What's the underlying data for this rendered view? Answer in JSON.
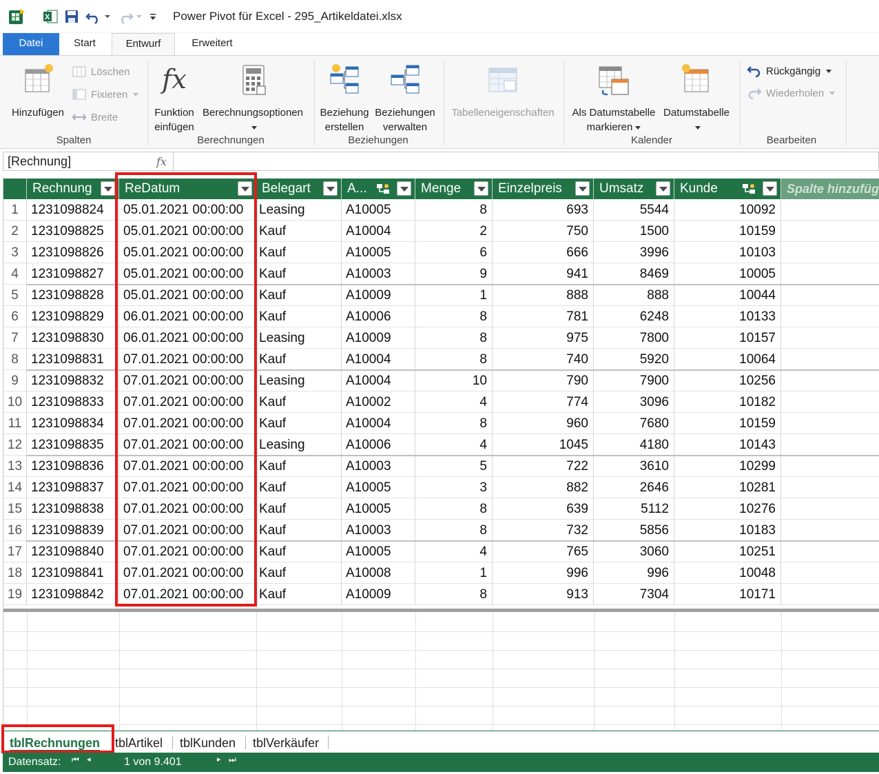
{
  "window": {
    "title": "Power Pivot für Excel - 295_Artikeldatei.xlsx"
  },
  "tabs": [
    {
      "label": "Datei"
    },
    {
      "label": "Start"
    },
    {
      "label": "Entwurf"
    },
    {
      "label": "Erweitert"
    }
  ],
  "ribbon": {
    "spalten": {
      "label": "Spalten",
      "add": "Hinzufügen",
      "delete": "Löschen",
      "freeze": "Fixieren",
      "width": "Breite"
    },
    "berechnungen": {
      "label": "Berechnungen",
      "insert_function_1": "Funktion",
      "insert_function_2": "einfügen",
      "options": "Berechnungsoptionen"
    },
    "beziehungen": {
      "label": "Beziehungen",
      "create_1": "Beziehung",
      "create_2": "erstellen",
      "manage_1": "Beziehungen",
      "manage_2": "verwalten"
    },
    "table_props": "Tabelleneigenschaften",
    "kalender": {
      "label": "Kalender",
      "mark_1": "Als Datumstabelle",
      "mark_2": "markieren",
      "date_table": "Datumstabelle"
    },
    "bearbeiten": {
      "label": "Bearbeiten",
      "undo": "Rückgängig",
      "redo": "Wiederholen"
    }
  },
  "formula_bar": {
    "name_box": "[Rechnung]",
    "fx": "fx"
  },
  "table": {
    "headers": [
      "Rechnung",
      "ReDatum",
      "Belegart",
      "A...",
      "Menge",
      "Einzelpreis",
      "Umsatz",
      "Kunde",
      "Spalte hinzufüg"
    ],
    "rows": [
      [
        "1",
        "1231098824",
        "05.01.2021 00:00:00",
        "Leasing",
        "A10005",
        "8",
        "693",
        "5544",
        "10092"
      ],
      [
        "2",
        "1231098825",
        "05.01.2021 00:00:00",
        "Kauf",
        "A10004",
        "2",
        "750",
        "1500",
        "10159"
      ],
      [
        "3",
        "1231098826",
        "05.01.2021 00:00:00",
        "Kauf",
        "A10005",
        "6",
        "666",
        "3996",
        "10103"
      ],
      [
        "4",
        "1231098827",
        "05.01.2021 00:00:00",
        "Kauf",
        "A10003",
        "9",
        "941",
        "8469",
        "10005"
      ],
      [
        "5",
        "1231098828",
        "05.01.2021 00:00:00",
        "Kauf",
        "A10009",
        "1",
        "888",
        "888",
        "10044"
      ],
      [
        "6",
        "1231098829",
        "06.01.2021 00:00:00",
        "Kauf",
        "A10006",
        "8",
        "781",
        "6248",
        "10133"
      ],
      [
        "7",
        "1231098830",
        "06.01.2021 00:00:00",
        "Leasing",
        "A10009",
        "8",
        "975",
        "7800",
        "10157"
      ],
      [
        "8",
        "1231098831",
        "07.01.2021 00:00:00",
        "Kauf",
        "A10004",
        "8",
        "740",
        "5920",
        "10064"
      ],
      [
        "9",
        "1231098832",
        "07.01.2021 00:00:00",
        "Leasing",
        "A10004",
        "10",
        "790",
        "7900",
        "10256"
      ],
      [
        "10",
        "1231098833",
        "07.01.2021 00:00:00",
        "Kauf",
        "A10002",
        "4",
        "774",
        "3096",
        "10182"
      ],
      [
        "11",
        "1231098834",
        "07.01.2021 00:00:00",
        "Kauf",
        "A10004",
        "8",
        "960",
        "7680",
        "10159"
      ],
      [
        "12",
        "1231098835",
        "07.01.2021 00:00:00",
        "Leasing",
        "A10006",
        "4",
        "1045",
        "4180",
        "10143"
      ],
      [
        "13",
        "1231098836",
        "07.01.2021 00:00:00",
        "Kauf",
        "A10003",
        "5",
        "722",
        "3610",
        "10299"
      ],
      [
        "14",
        "1231098837",
        "07.01.2021 00:00:00",
        "Kauf",
        "A10005",
        "3",
        "882",
        "2646",
        "10281"
      ],
      [
        "15",
        "1231098838",
        "07.01.2021 00:00:00",
        "Kauf",
        "A10005",
        "8",
        "639",
        "5112",
        "10276"
      ],
      [
        "16",
        "1231098839",
        "07.01.2021 00:00:00",
        "Kauf",
        "A10003",
        "8",
        "732",
        "5856",
        "10183"
      ],
      [
        "17",
        "1231098840",
        "07.01.2021 00:00:00",
        "Kauf",
        "A10005",
        "4",
        "765",
        "3060",
        "10251"
      ],
      [
        "18",
        "1231098841",
        "07.01.2021 00:00:00",
        "Kauf",
        "A10008",
        "1",
        "996",
        "996",
        "10048"
      ],
      [
        "19",
        "1231098842",
        "07.01.2021 00:00:00",
        "Kauf",
        "A10009",
        "8",
        "913",
        "7304",
        "10171"
      ]
    ]
  },
  "sheets": [
    "tblRechnungen",
    "tblArtikel",
    "tblKunden",
    "tblVerkäufer"
  ],
  "status": {
    "label": "Datensatz:",
    "position": "1 von 9.401"
  },
  "colors": {
    "header_green": "#217346",
    "file_tab_blue": "#2b78d4",
    "highlight_red": "#e21b1b"
  }
}
